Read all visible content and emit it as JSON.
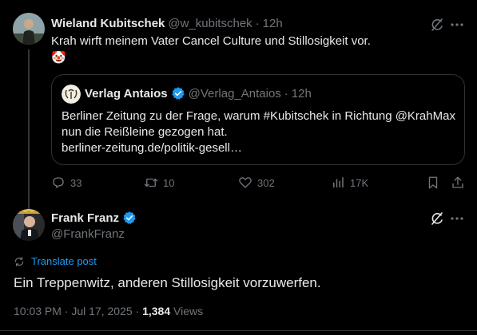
{
  "tweet1": {
    "name": "Wieland Kubitschek",
    "handle": "@w_kubitschek",
    "sep": "·",
    "time": "12h",
    "text": "Krah wirft meinem Vater Cancel Culture und Stillosigkeit vor.",
    "emoji": "🤡",
    "quote": {
      "name": "Verlag Antaios",
      "handle": "@Verlag_Antaios",
      "sep": "·",
      "time": "12h",
      "line1": "Berliner Zeitung zu der Frage, warum #Kubitschek in Richtung @KrahMax",
      "line2": "nun die Reißleine gezogen hat.",
      "line3": "berliner-zeitung.de/politik-gesell…"
    },
    "actions": {
      "replies": "33",
      "reposts": "10",
      "likes": "302",
      "views": "17K"
    }
  },
  "tweet2": {
    "name": "Frank Franz",
    "handle": "@FrankFranz",
    "translate_label": "Translate post",
    "text": "Ein Treppenwitz, anderen Stillosigkeit vorzuwerfen.",
    "timestamp": "10:03 PM · Jul 17, 2025 · ",
    "views_count": "1,384",
    "views_label": " Views"
  },
  "colors": {
    "background": "#000000",
    "text": "#e7e9ea",
    "muted": "#71767b",
    "accent": "#1d9bf0",
    "border": "#2f3336"
  },
  "icons": [
    "grok-icon",
    "more-icon",
    "verified-icon",
    "reply-icon",
    "repost-icon",
    "like-icon",
    "views-icon",
    "bookmark-icon",
    "share-icon",
    "translate-icon"
  ]
}
